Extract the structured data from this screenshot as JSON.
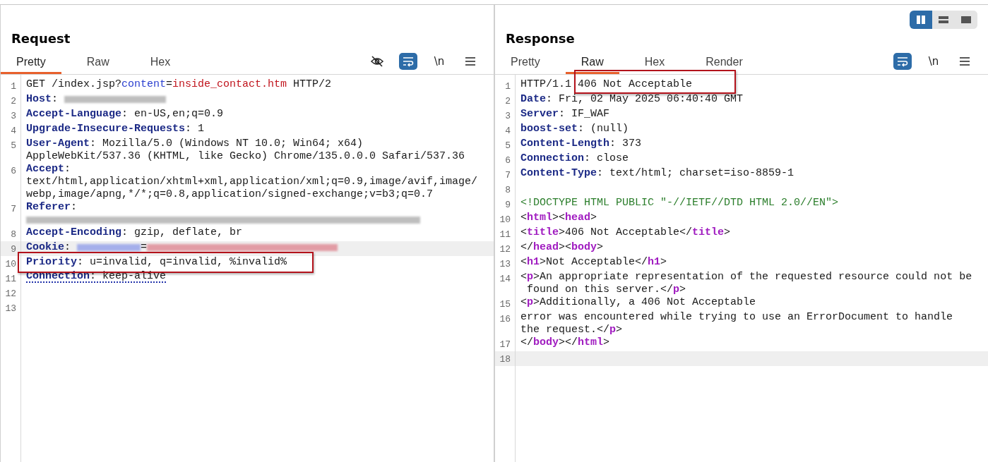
{
  "layout_modes": [
    {
      "kind": "columns",
      "selected": true
    },
    {
      "kind": "rows",
      "selected": false
    },
    {
      "kind": "single",
      "selected": false
    }
  ],
  "panels": [
    {
      "title": "Request",
      "tabs": [
        {
          "label": "Pretty",
          "selected": true
        },
        {
          "label": "Raw",
          "selected": false
        },
        {
          "label": "Hex",
          "selected": false
        }
      ],
      "tools": [
        {
          "kind": "hide",
          "on": false
        },
        {
          "kind": "wrap",
          "on": true
        },
        {
          "kind": "newline",
          "label": "\\n",
          "on": false
        },
        {
          "kind": "menu",
          "on": false
        }
      ],
      "lines": [
        {
          "number": "1",
          "rows": [
            [
              {
                "kind": "plain",
                "text": "GET /index.jsp?"
              },
              {
                "kind": "param",
                "text": "content"
              },
              {
                "kind": "plain",
                "text": "="
              },
              {
                "kind": "value",
                "text": "inside_contact.htm"
              },
              {
                "kind": "plain",
                "text": " HTTP/2"
              }
            ]
          ]
        },
        {
          "number": "2",
          "rows": [
            [
              {
                "kind": "header",
                "text": "Host"
              },
              {
                "kind": "plain",
                "text": ": "
              },
              {
                "kind": "redacted-host"
              }
            ]
          ]
        },
        {
          "number": "3",
          "rows": [
            [
              {
                "kind": "header",
                "text": "Accept-Language"
              },
              {
                "kind": "plain",
                "text": ": en-US,en;q=0.9"
              }
            ]
          ]
        },
        {
          "number": "4",
          "rows": [
            [
              {
                "kind": "header",
                "text": "Upgrade-Insecure-Requests"
              },
              {
                "kind": "plain",
                "text": ": 1"
              }
            ]
          ]
        },
        {
          "number": "5",
          "rows": [
            [
              {
                "kind": "header",
                "text": "User-Agent"
              },
              {
                "kind": "plain",
                "text": ": Mozilla/5.0 (Windows NT 10.0; Win64; x64)"
              }
            ],
            [
              {
                "kind": "plain",
                "text": "AppleWebKit/537.36 (KHTML, like Gecko) Chrome/135.0.0.0 Safari/537.36"
              }
            ]
          ]
        },
        {
          "number": "6",
          "rows": [
            [
              {
                "kind": "header",
                "text": "Accept"
              },
              {
                "kind": "plain",
                "text": ":"
              }
            ],
            [
              {
                "kind": "plain",
                "text": "text/html,application/xhtml+xml,application/xml;q=0.9,image/avif,image/"
              }
            ],
            [
              {
                "kind": "plain",
                "text": "webp,image/apng,*/*;q=0.8,application/signed-exchange;v=b3;q=0.7"
              }
            ]
          ]
        },
        {
          "number": "7",
          "rows": [
            [
              {
                "kind": "header",
                "text": "Referer"
              },
              {
                "kind": "plain",
                "text": ":"
              }
            ],
            [
              {
                "kind": "redacted-url"
              }
            ]
          ]
        },
        {
          "number": "8",
          "rows": [
            [
              {
                "kind": "header",
                "text": "Accept-Encoding"
              },
              {
                "kind": "plain",
                "text": ": gzip, deflate, br"
              }
            ]
          ]
        },
        {
          "number": "9",
          "current": true,
          "rows": [
            [
              {
                "kind": "header",
                "text": "Cookie"
              },
              {
                "kind": "plain",
                "text": ": "
              },
              {
                "kind": "redacted-param"
              },
              {
                "kind": "plain",
                "text": "="
              },
              {
                "kind": "redacted-value"
              }
            ]
          ]
        },
        {
          "number": "10",
          "boxed": true,
          "rows": [
            [
              {
                "kind": "header",
                "text": "Priority"
              },
              {
                "kind": "plain",
                "text": ": u=invalid, q=invalid, %invalid%"
              }
            ]
          ]
        },
        {
          "number": "11",
          "flagged": true,
          "rows": [
            [
              {
                "kind": "header",
                "text": "Connection"
              },
              {
                "kind": "plain",
                "text": ": keep-alive"
              }
            ]
          ]
        },
        {
          "number": "12",
          "rows": [
            []
          ]
        },
        {
          "number": "13",
          "rows": [
            []
          ]
        }
      ]
    },
    {
      "title": "Response",
      "tabs": [
        {
          "label": "Pretty",
          "selected": false
        },
        {
          "label": "Raw",
          "selected": true
        },
        {
          "label": "Hex",
          "selected": false
        },
        {
          "label": "Render",
          "selected": false
        }
      ],
      "tools": [
        {
          "kind": "wrap",
          "on": true
        },
        {
          "kind": "newline",
          "label": "\\n",
          "on": false
        },
        {
          "kind": "menu",
          "on": false
        }
      ],
      "lines": [
        {
          "number": "1",
          "rows": [
            [
              {
                "kind": "plain",
                "text": "HTTP/1.1 "
              },
              {
                "kind": "plain",
                "text": "406 Not Acceptable",
                "boxed": true
              }
            ]
          ]
        },
        {
          "number": "2",
          "rows": [
            [
              {
                "kind": "header",
                "text": "Date"
              },
              {
                "kind": "plain",
                "text": ": Fri, 02 May 2025 06:40:40 GMT"
              }
            ]
          ]
        },
        {
          "number": "3",
          "rows": [
            [
              {
                "kind": "header",
                "text": "Server"
              },
              {
                "kind": "plain",
                "text": ": IF_WAF"
              }
            ]
          ]
        },
        {
          "number": "4",
          "rows": [
            [
              {
                "kind": "header",
                "text": "boost-set"
              },
              {
                "kind": "plain",
                "text": ": (null)"
              }
            ]
          ]
        },
        {
          "number": "5",
          "rows": [
            [
              {
                "kind": "header",
                "text": "Content-Length"
              },
              {
                "kind": "plain",
                "text": ": 373"
              }
            ]
          ]
        },
        {
          "number": "6",
          "rows": [
            [
              {
                "kind": "header",
                "text": "Connection"
              },
              {
                "kind": "plain",
                "text": ": close"
              }
            ]
          ]
        },
        {
          "number": "7",
          "rows": [
            [
              {
                "kind": "header",
                "text": "Content-Type"
              },
              {
                "kind": "plain",
                "text": ": text/html; charset=iso-8859-1"
              }
            ]
          ]
        },
        {
          "number": "8",
          "rows": [
            []
          ]
        },
        {
          "number": "9",
          "rows": [
            [
              {
                "kind": "doctype",
                "text": "<!DOCTYPE HTML PUBLIC \"-//IETF//DTD HTML 2.0//EN\">"
              }
            ]
          ]
        },
        {
          "number": "10",
          "rows": [
            [
              {
                "kind": "plain",
                "text": "<"
              },
              {
                "kind": "tag",
                "text": "html"
              },
              {
                "kind": "plain",
                "text": "><"
              },
              {
                "kind": "tag",
                "text": "head"
              },
              {
                "kind": "plain",
                "text": ">"
              }
            ]
          ]
        },
        {
          "number": "11",
          "rows": [
            [
              {
                "kind": "plain",
                "text": "<"
              },
              {
                "kind": "tag",
                "text": "title"
              },
              {
                "kind": "plain",
                "text": ">406 Not Acceptable</"
              },
              {
                "kind": "tag",
                "text": "title"
              },
              {
                "kind": "plain",
                "text": ">"
              }
            ]
          ]
        },
        {
          "number": "12",
          "rows": [
            [
              {
                "kind": "plain",
                "text": "</"
              },
              {
                "kind": "tag",
                "text": "head"
              },
              {
                "kind": "plain",
                "text": "><"
              },
              {
                "kind": "tag",
                "text": "body"
              },
              {
                "kind": "plain",
                "text": ">"
              }
            ]
          ]
        },
        {
          "number": "13",
          "rows": [
            [
              {
                "kind": "plain",
                "text": "<"
              },
              {
                "kind": "tag",
                "text": "h1"
              },
              {
                "kind": "plain",
                "text": ">Not Acceptable</"
              },
              {
                "kind": "tag",
                "text": "h1"
              },
              {
                "kind": "plain",
                "text": ">"
              }
            ]
          ]
        },
        {
          "number": "14",
          "rows": [
            [
              {
                "kind": "plain",
                "text": "<"
              },
              {
                "kind": "tag",
                "text": "p"
              },
              {
                "kind": "plain",
                "text": ">An appropriate representation of the requested resource could not be"
              }
            ],
            [
              {
                "kind": "indent"
              },
              {
                "kind": "plain",
                "text": "found on this server.</"
              },
              {
                "kind": "tag",
                "text": "p"
              },
              {
                "kind": "plain",
                "text": ">"
              }
            ]
          ]
        },
        {
          "number": "15",
          "rows": [
            [
              {
                "kind": "plain",
                "text": "<"
              },
              {
                "kind": "tag",
                "text": "p"
              },
              {
                "kind": "plain",
                "text": ">Additionally, a 406 Not Acceptable"
              }
            ]
          ]
        },
        {
          "number": "16",
          "rows": [
            [
              {
                "kind": "plain",
                "text": "error was encountered while trying to use an ErrorDocument to handle"
              }
            ],
            [
              {
                "kind": "plain",
                "text": "the request.</"
              },
              {
                "kind": "tag",
                "text": "p"
              },
              {
                "kind": "plain",
                "text": ">"
              }
            ]
          ]
        },
        {
          "number": "17",
          "rows": [
            [
              {
                "kind": "plain",
                "text": "</"
              },
              {
                "kind": "tag",
                "text": "body"
              },
              {
                "kind": "plain",
                "text": "></"
              },
              {
                "kind": "tag",
                "text": "html"
              },
              {
                "kind": "plain",
                "text": ">"
              }
            ]
          ]
        },
        {
          "number": "18",
          "current": true,
          "rows": [
            []
          ]
        }
      ]
    }
  ]
}
